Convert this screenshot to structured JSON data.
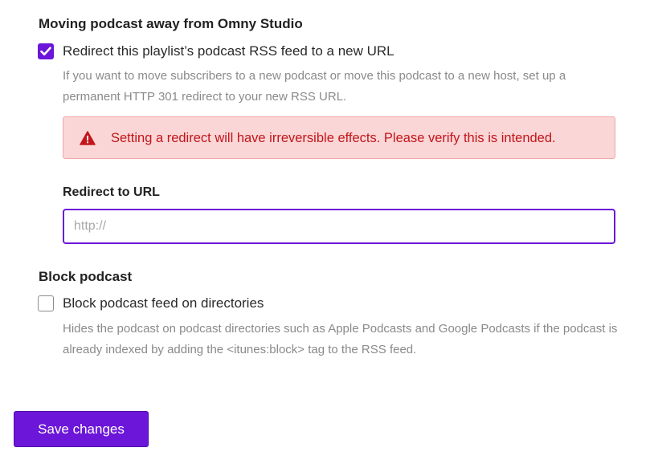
{
  "colors": {
    "accent": "#6b16d8",
    "alert_bg": "#fbd6d6",
    "alert_border": "#f0a7a7",
    "alert_text": "#c1161b",
    "help_text": "#8a8a8a"
  },
  "redirect_section": {
    "title": "Moving podcast away from Omny Studio",
    "checkbox": {
      "label": "Redirect this playlist’s podcast RSS feed to a new URL",
      "checked": true,
      "icon": "check-icon"
    },
    "help": "If you want to move subscribers to a new podcast or move this podcast to a new host, set up a permanent HTTP 301 redirect to your new RSS URL.",
    "alert": {
      "icon": "warning-triangle-icon",
      "text": "Setting a redirect will have irreversible effects. Please verify this is intended."
    },
    "url_field": {
      "label": "Redirect to URL",
      "placeholder": "http://",
      "value": ""
    }
  },
  "block_section": {
    "title": "Block podcast",
    "checkbox": {
      "label": "Block podcast feed on directories",
      "checked": false
    },
    "help": "Hides the podcast on podcast directories such as Apple Podcasts and Google Podcasts if the podcast is already indexed by adding the <itunes:block> tag to the RSS feed."
  },
  "actions": {
    "save_label": "Save changes"
  }
}
